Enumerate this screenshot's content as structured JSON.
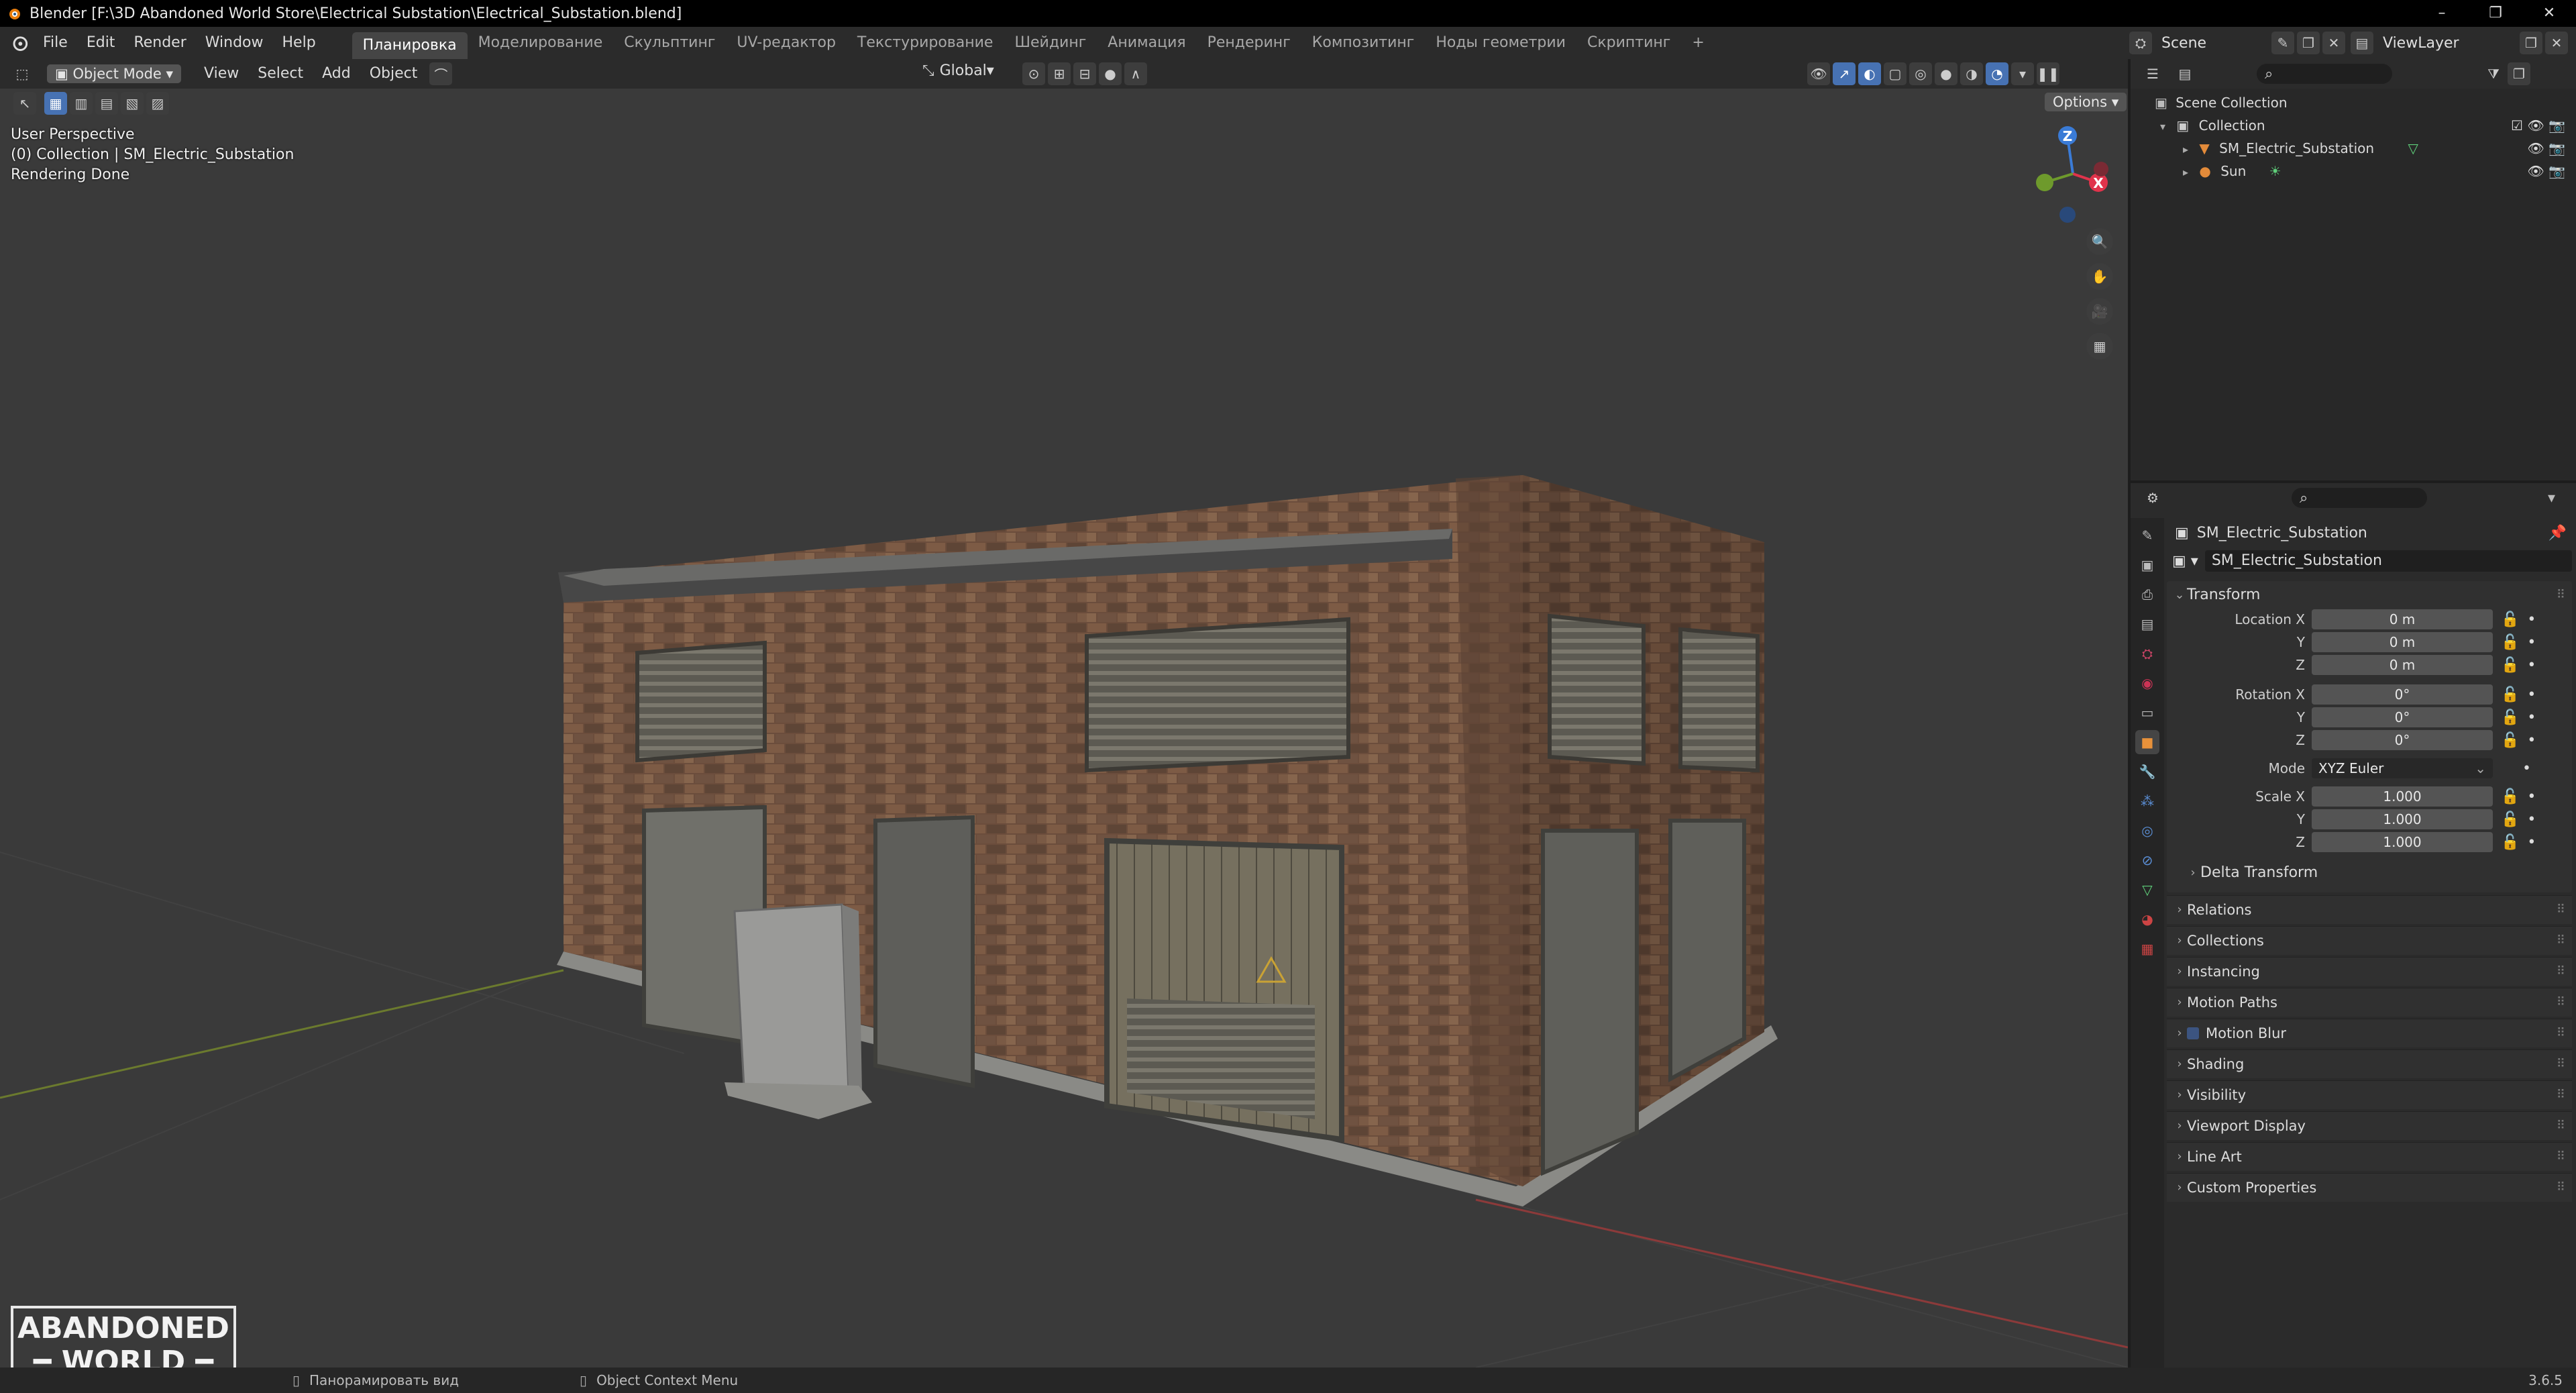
{
  "window": {
    "title": "Blender [F:\\3D Abandoned World Store\\Electrical Substation\\Electrical_Substation.blend]",
    "controls": [
      "–",
      "❐",
      "✕"
    ]
  },
  "menus": [
    "File",
    "Edit",
    "Render",
    "Window",
    "Help"
  ],
  "workspaces": [
    "Планировка",
    "Моделирование",
    "Скульптинг",
    "UV-редактор",
    "Текстурирование",
    "Шейдинг",
    "Анимация",
    "Рендеринг",
    "Композитинг",
    "Ноды геометрии",
    "Скриптинг",
    "+"
  ],
  "scene": {
    "name": "Scene",
    "view_layer": "ViewLayer"
  },
  "viewport": {
    "mode": "Object Mode",
    "header_menus": [
      "View",
      "Select",
      "Add",
      "Object"
    ],
    "transform_orientation": "Global",
    "options_label": "Options",
    "overlay_info": [
      "User Perspective",
      "(0) Collection | SM_Electric_Substation",
      "Rendering Done"
    ],
    "gizmo_axes": [
      "Z",
      "X"
    ],
    "watermark": [
      "ABANDONED",
      "WORLD"
    ]
  },
  "outliner": {
    "root": "Scene Collection",
    "items": [
      {
        "label": "Collection"
      },
      {
        "label": "SM_Electric_Substation"
      },
      {
        "label": "Sun"
      }
    ]
  },
  "properties": {
    "object_name": "SM_Electric_Substation",
    "data_name": "SM_Electric_Substation",
    "transform": {
      "title": "Transform",
      "location_label": "Location X",
      "rotation_label": "Rotation X",
      "scale_label": "Scale X",
      "y_label": "Y",
      "z_label": "Z",
      "location": [
        "0 m",
        "0 m",
        "0 m"
      ],
      "rotation": [
        "0°",
        "0°",
        "0°"
      ],
      "mode_label": "Mode",
      "mode": "XYZ Euler",
      "scale": [
        "1.000",
        "1.000",
        "1.000"
      ],
      "delta": "Delta Transform"
    },
    "panels": [
      "Relations",
      "Collections",
      "Instancing",
      "Motion Paths",
      "Motion Blur",
      "Shading",
      "Visibility",
      "Viewport Display",
      "Line Art",
      "Custom Properties"
    ]
  },
  "status": {
    "pan": "Панорамировать вид",
    "context_menu": "Object Context Menu",
    "version": "3.6.5"
  },
  "colors": {
    "accent": "#4772b3",
    "brick": "#7a5a45",
    "x_axis": "#e0334b",
    "y_axis": "#6e9a2c",
    "z_axis": "#3a7bd6"
  }
}
